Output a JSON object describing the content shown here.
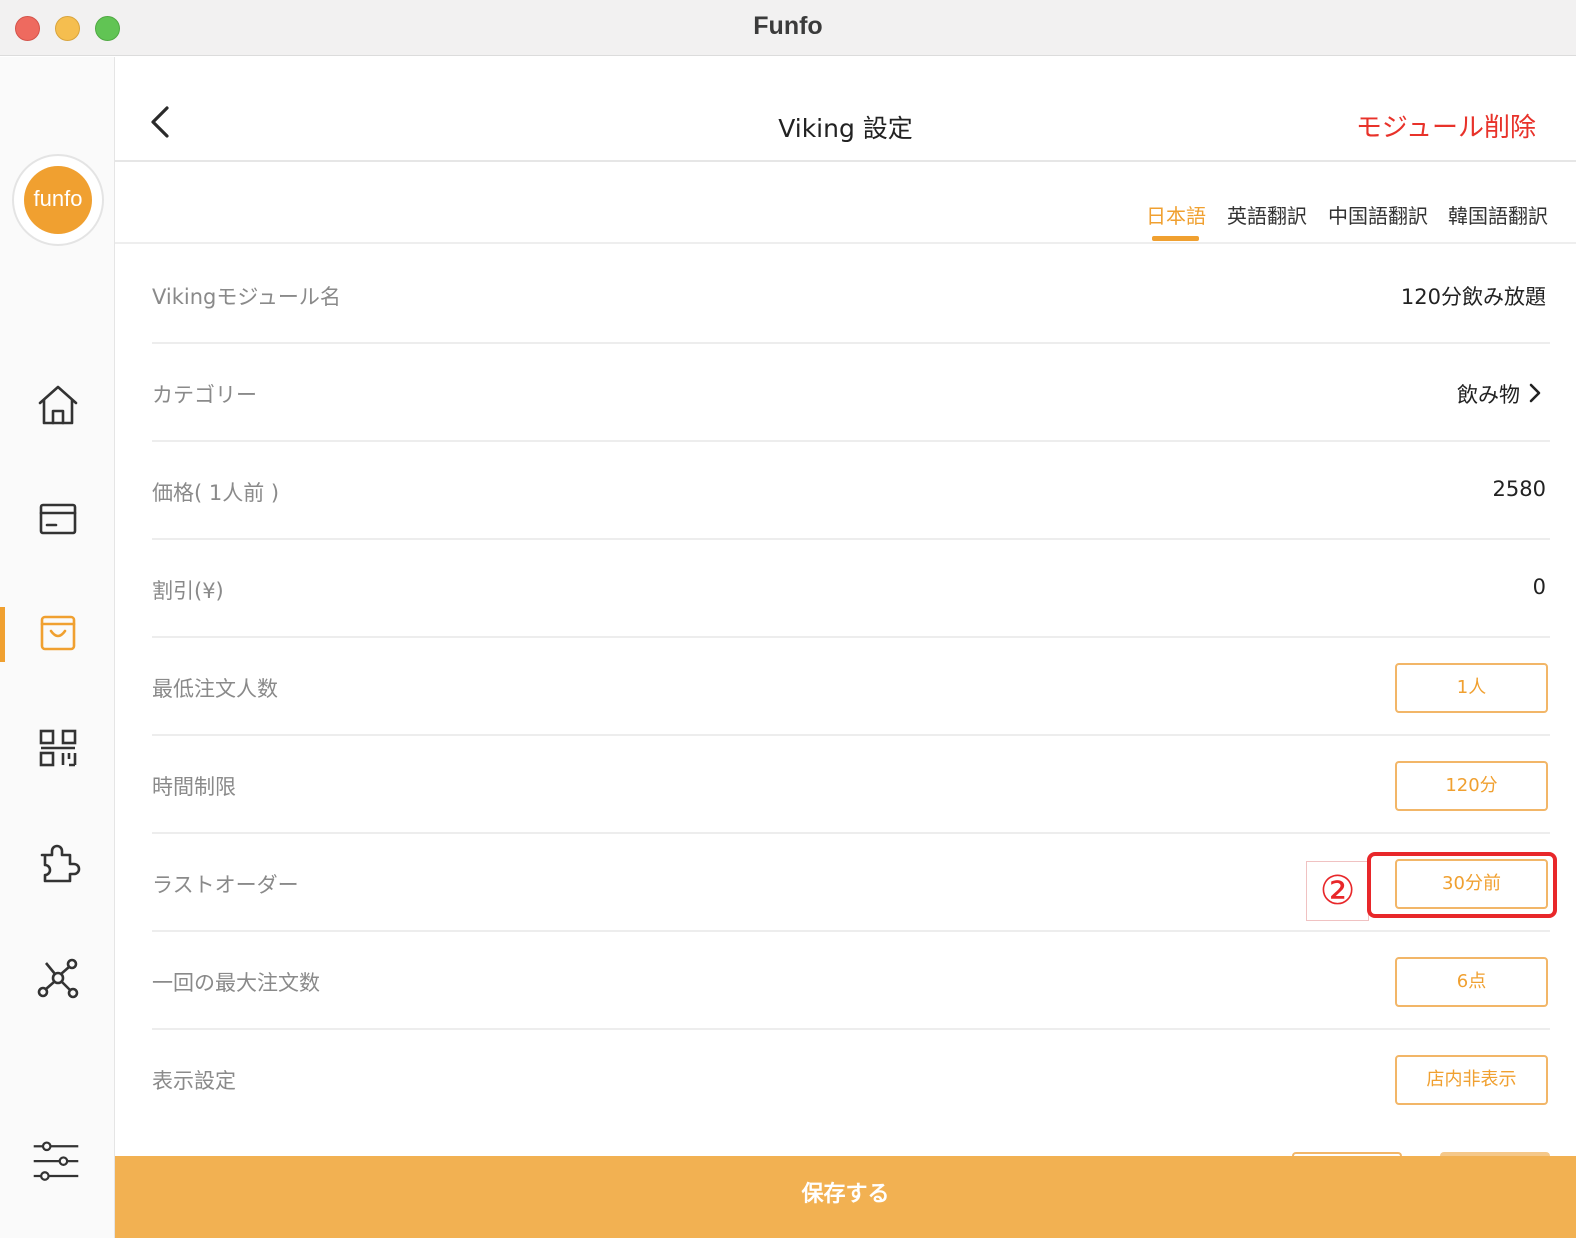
{
  "window": {
    "title": "Funfo"
  },
  "sidebar": {
    "logo_text": "funfo"
  },
  "header": {
    "title": "Viking 設定",
    "delete_label": "モジュール削除"
  },
  "tabs": [
    {
      "label": "日本語",
      "active": true
    },
    {
      "label": "英語翻訳",
      "active": false
    },
    {
      "label": "中国語翻訳",
      "active": false
    },
    {
      "label": "韓国語翻訳",
      "active": false
    }
  ],
  "form": {
    "module_name": {
      "label": "Vikingモジュール名",
      "value": "120分飲み放題"
    },
    "category": {
      "label": "カテゴリー",
      "value": "飲み物"
    },
    "price": {
      "label": "価格( 1人前 )",
      "value": "2580"
    },
    "discount": {
      "label": "割引(¥)",
      "value": "0"
    },
    "min_people": {
      "label": "最低注文人数",
      "value": "1人"
    },
    "time_limit": {
      "label": "時間制限",
      "value": "120分"
    },
    "last_order": {
      "label": "ラストオーダー",
      "value": "30分前"
    },
    "max_items": {
      "label": "一回の最大注文数",
      "value": "6点"
    },
    "display": {
      "label": "表示設定",
      "value": "店内非表示"
    }
  },
  "annotation": {
    "number": "②"
  },
  "footer": {
    "save_label": "保存する"
  },
  "colors": {
    "accent": "#f0a030",
    "danger": "#e8322a",
    "save_bar": "#f2b152"
  }
}
